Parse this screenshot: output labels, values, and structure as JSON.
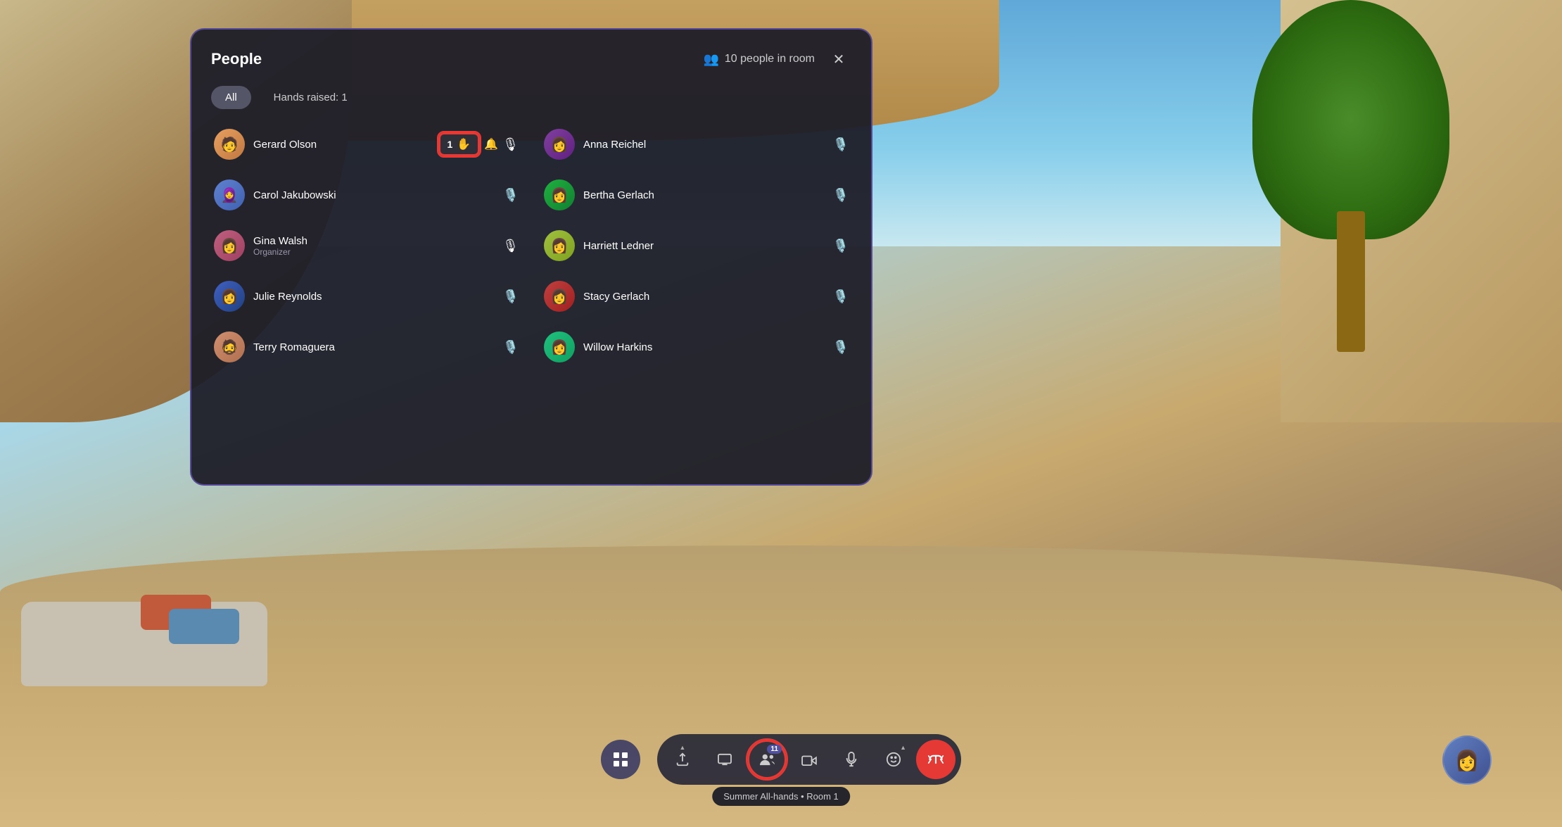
{
  "background": {
    "type": "virtual_environment"
  },
  "panel": {
    "title": "People",
    "people_count_label": "10 people in room",
    "close_label": "✕"
  },
  "tabs": {
    "all_label": "All",
    "hands_raised_label": "Hands raised: 1"
  },
  "people": [
    {
      "id": "gerard-olson",
      "name": "Gerard Olson",
      "role": "",
      "avatar_emoji": "🧑",
      "avatar_class": "avatar-gerard",
      "hand_count": "1",
      "has_hand_raised": true,
      "mic_active": true,
      "column": "left"
    },
    {
      "id": "anna-reichel",
      "name": "Anna Reichel",
      "role": "",
      "avatar_emoji": "👩",
      "avatar_class": "avatar-anna",
      "has_hand_raised": false,
      "mic_active": false,
      "column": "right"
    },
    {
      "id": "carol-jakubowski",
      "name": "Carol Jakubowski",
      "role": "",
      "avatar_emoji": "🧕",
      "avatar_class": "avatar-carol",
      "has_hand_raised": false,
      "mic_active": false,
      "column": "left"
    },
    {
      "id": "bertha-gerlach",
      "name": "Bertha Gerlach",
      "role": "",
      "avatar_emoji": "👩",
      "avatar_class": "avatar-bertha",
      "has_hand_raised": false,
      "mic_active": false,
      "column": "right"
    },
    {
      "id": "gina-walsh",
      "name": "Gina Walsh",
      "role": "Organizer",
      "avatar_emoji": "👩",
      "avatar_class": "avatar-gina",
      "has_hand_raised": false,
      "mic_active": true,
      "column": "left"
    },
    {
      "id": "harriett-ledner",
      "name": "Harriett Ledner",
      "role": "",
      "avatar_emoji": "👩",
      "avatar_class": "avatar-harriett",
      "has_hand_raised": false,
      "mic_active": false,
      "column": "right"
    },
    {
      "id": "julie-reynolds",
      "name": "Julie Reynolds",
      "role": "",
      "avatar_emoji": "👩",
      "avatar_class": "avatar-julie",
      "has_hand_raised": false,
      "mic_active": false,
      "column": "left"
    },
    {
      "id": "stacy-gerlach",
      "name": "Stacy Gerlach",
      "role": "",
      "avatar_emoji": "👩",
      "avatar_class": "avatar-stacy",
      "has_hand_raised": false,
      "mic_active": false,
      "column": "right"
    },
    {
      "id": "terry-romaguera",
      "name": "Terry Romaguera",
      "role": "",
      "avatar_emoji": "🧔",
      "avatar_class": "avatar-terry",
      "has_hand_raised": false,
      "mic_active": false,
      "column": "left"
    },
    {
      "id": "willow-harkins",
      "name": "Willow Harkins",
      "role": "",
      "avatar_emoji": "👩",
      "avatar_class": "avatar-willow",
      "has_hand_raised": false,
      "mic_active": false,
      "column": "right"
    }
  ],
  "toolbar": {
    "apps_icon": "⠿",
    "share_icon": "⬆",
    "present_icon": "▭",
    "people_icon": "👥",
    "people_count": "11",
    "camera_icon": "📷",
    "mic_icon": "🎙",
    "emoji_icon": "🙂",
    "leave_icon": "📵",
    "tooltip": "Summer All-hands • Room 1"
  },
  "self_avatar_emoji": "👩"
}
